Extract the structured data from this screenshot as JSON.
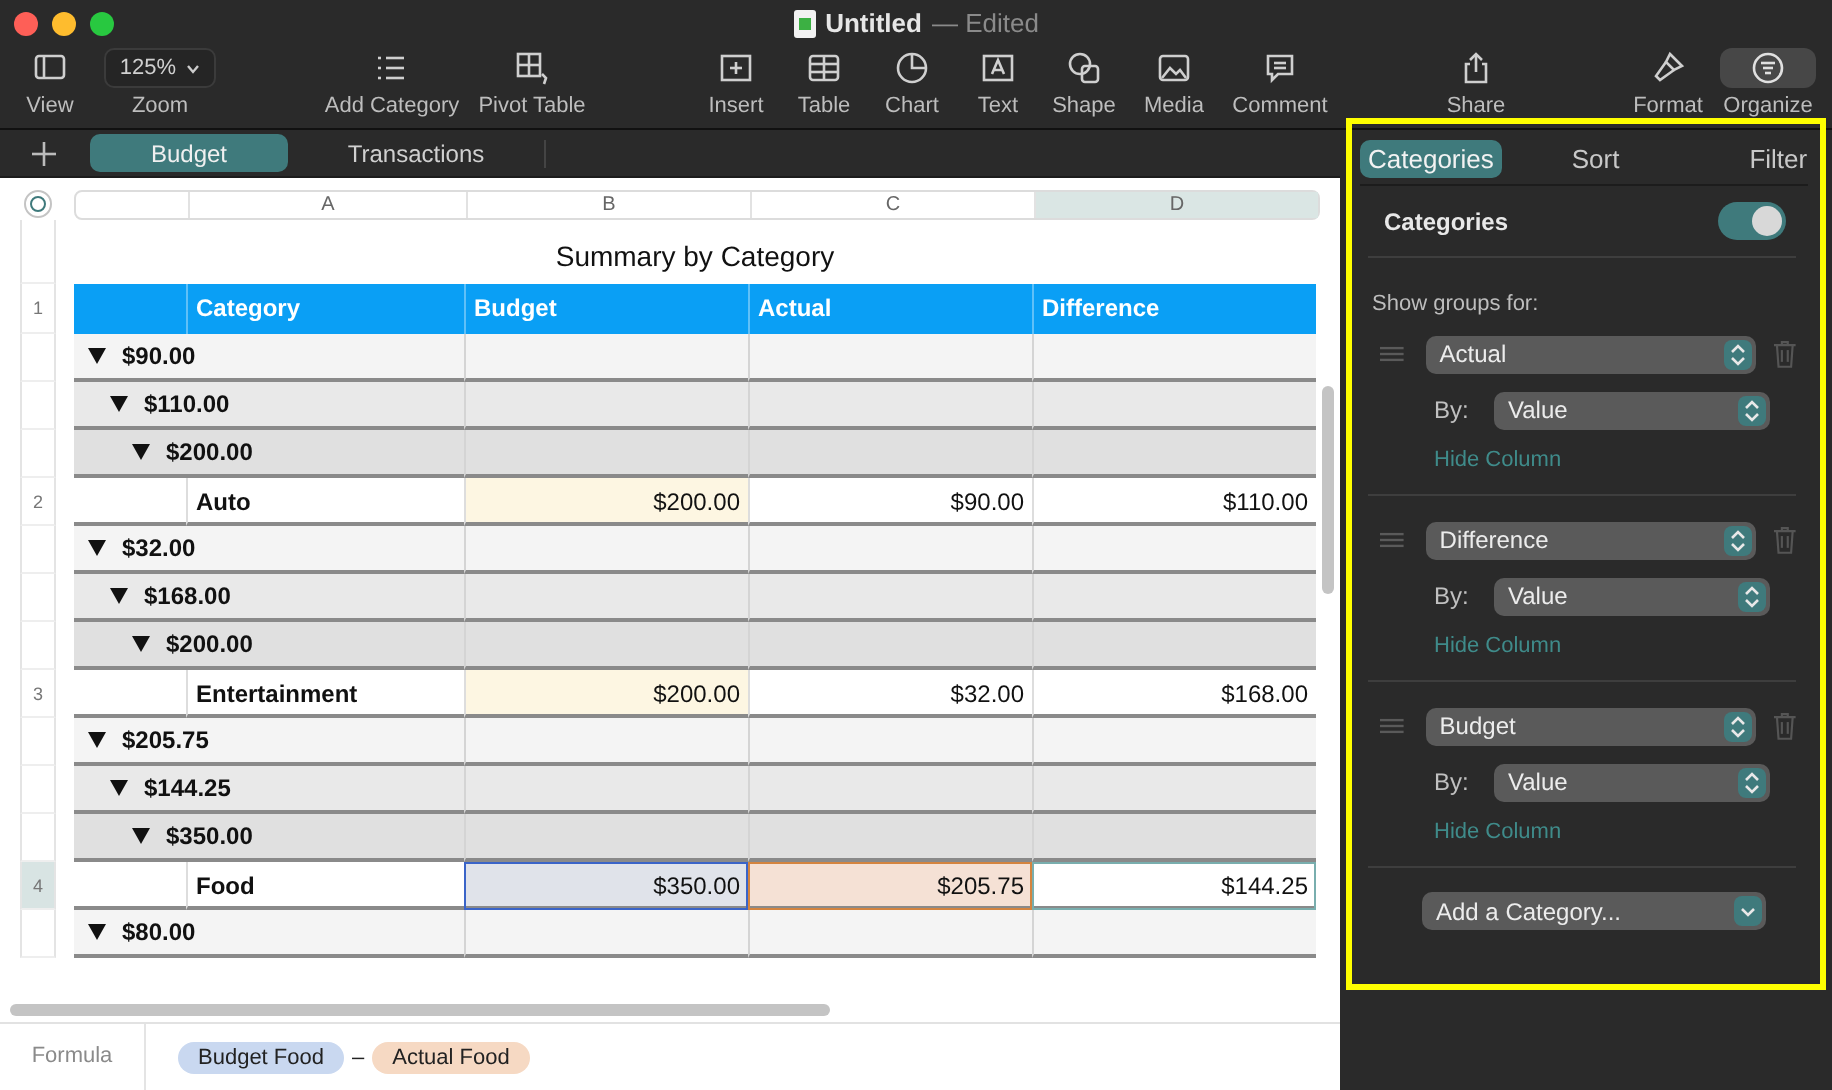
{
  "window": {
    "title": "Untitled",
    "status": "— Edited"
  },
  "toolbar": {
    "items": [
      {
        "kind": "button",
        "label": "View",
        "selected": false
      },
      {
        "kind": "popup",
        "label": "Zoom",
        "value": "125%",
        "selected": false
      },
      {
        "kind": "button",
        "label": "Add Category",
        "selected": false
      },
      {
        "kind": "button",
        "label": "Pivot Table",
        "selected": false
      },
      {
        "kind": "button",
        "label": "Insert",
        "selected": false
      },
      {
        "kind": "button",
        "label": "Table",
        "selected": false
      },
      {
        "kind": "button",
        "label": "Chart",
        "selected": false
      },
      {
        "kind": "button",
        "label": "Text",
        "selected": false
      },
      {
        "kind": "button",
        "label": "Shape",
        "selected": false
      },
      {
        "kind": "button",
        "label": "Media",
        "selected": false
      },
      {
        "kind": "button",
        "label": "Comment",
        "selected": false
      },
      {
        "kind": "button",
        "label": "Share",
        "selected": false
      },
      {
        "kind": "button",
        "label": "Format",
        "selected": false
      },
      {
        "kind": "button",
        "label": "Organize",
        "selected": true
      }
    ]
  },
  "sheet_tabs": [
    {
      "label": "Budget",
      "selected": true
    },
    {
      "label": "Transactions",
      "selected": false
    }
  ],
  "table": {
    "title": "Summary by Category",
    "column_letters": [
      {
        "label": "A",
        "selected": false
      },
      {
        "label": "B",
        "selected": false
      },
      {
        "label": "C",
        "selected": false
      },
      {
        "label": "D",
        "selected": true
      }
    ],
    "header_row_number": "1",
    "columns": [
      "",
      "Category",
      "Budget",
      "Actual",
      "Difference"
    ],
    "rows": [
      {
        "kind": "group",
        "label": "$90.00",
        "expanded": true,
        "children": [
          {
            "kind": "group",
            "label": "$110.00",
            "expanded": true,
            "children": [
              {
                "kind": "group",
                "label": "$200.00",
                "expanded": true,
                "children": [
                  {
                    "kind": "record",
                    "row_number": "2",
                    "selected": false,
                    "cells": [
                      {
                        "text": "Auto",
                        "selected": false
                      },
                      {
                        "text": "$200.00",
                        "color": "#fdf6e2",
                        "selected": false
                      },
                      {
                        "text": "$90.00",
                        "selected": false
                      },
                      {
                        "text": "$110.00",
                        "selected": false
                      }
                    ]
                  }
                ]
              }
            ]
          }
        ]
      },
      {
        "kind": "group",
        "label": "$32.00",
        "expanded": true,
        "children": [
          {
            "kind": "group",
            "label": "$168.00",
            "expanded": true,
            "children": [
              {
                "kind": "group",
                "label": "$200.00",
                "expanded": true,
                "children": [
                  {
                    "kind": "record",
                    "row_number": "3",
                    "selected": false,
                    "cells": [
                      {
                        "text": "Entertainment",
                        "selected": false
                      },
                      {
                        "text": "$200.00",
                        "color": "#fdf6e2",
                        "selected": false
                      },
                      {
                        "text": "$32.00",
                        "selected": false
                      },
                      {
                        "text": "$168.00",
                        "selected": false
                      }
                    ]
                  }
                ]
              }
            ]
          }
        ]
      },
      {
        "kind": "group",
        "label": "$205.75",
        "expanded": true,
        "children": [
          {
            "kind": "group",
            "label": "$144.25",
            "expanded": true,
            "children": [
              {
                "kind": "group",
                "label": "$350.00",
                "expanded": true,
                "children": [
                  {
                    "kind": "record",
                    "row_number": "4",
                    "selected": true,
                    "cells": [
                      {
                        "text": "Food",
                        "selected": false
                      },
                      {
                        "text": "$350.00",
                        "color": "#e0e3ea",
                        "selected": false
                      },
                      {
                        "text": "$205.75",
                        "color": "#f5e1d5",
                        "selected": false
                      },
                      {
                        "text": "$144.25",
                        "selected": true
                      }
                    ]
                  }
                ]
              }
            ]
          }
        ]
      },
      {
        "kind": "group",
        "label": "$80.00",
        "expanded": true,
        "children": []
      }
    ]
  },
  "formula": {
    "label": "Formula",
    "tokens": [
      {
        "kind": "reference",
        "text": "Budget Food",
        "color": "#c9d8f0"
      },
      {
        "kind": "operator",
        "text": "–"
      },
      {
        "kind": "reference",
        "text": "Actual Food",
        "color": "#f6d9c3"
      }
    ]
  },
  "sidebar": {
    "tabs": [
      {
        "label": "Categories",
        "selected": true
      },
      {
        "label": "Sort",
        "selected": false
      },
      {
        "label": "Filter",
        "selected": false
      }
    ],
    "section_title": "Categories",
    "categories_on": true,
    "groups_label": "Show groups for:",
    "groups": [
      {
        "field": "Actual",
        "by_label": "By:",
        "by": "Value",
        "link": "Hide Column"
      },
      {
        "field": "Difference",
        "by_label": "By:",
        "by": "Value",
        "link": "Hide Column"
      },
      {
        "field": "Budget",
        "by_label": "By:",
        "by": "Value",
        "link": "Hide Column"
      }
    ],
    "add_button": "Add a Category..."
  }
}
